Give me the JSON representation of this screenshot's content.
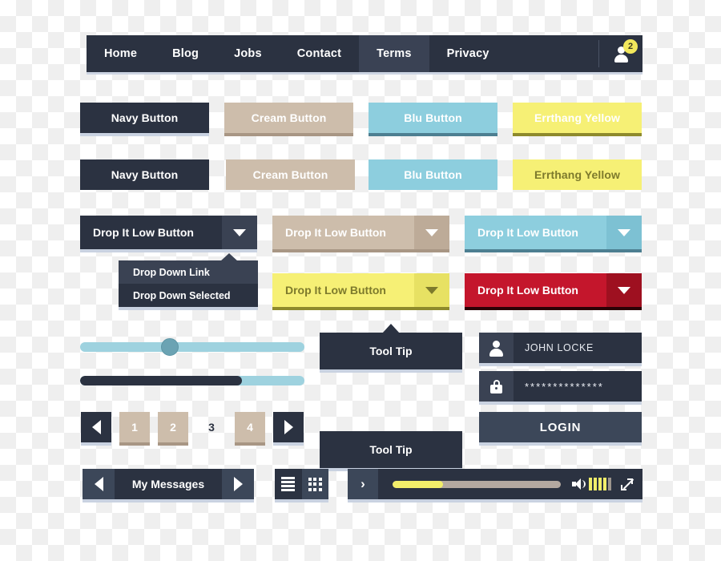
{
  "navbar": {
    "items": [
      {
        "label": "Home",
        "active": false
      },
      {
        "label": "Blog",
        "active": false
      },
      {
        "label": "Jobs",
        "active": false
      },
      {
        "label": "Contact",
        "active": false
      },
      {
        "label": "Terms",
        "active": true
      },
      {
        "label": "Privacy",
        "active": false
      }
    ],
    "user_icon": "user-icon",
    "badge_count": "2",
    "badge_color": "#f2e85c",
    "bg_color": "#2b3241",
    "active_bg_color": "#3a4254"
  },
  "buttons_row_raised": [
    {
      "label": "Navy Button",
      "style": "navy",
      "color": "#2b3241"
    },
    {
      "label": "Cream Button",
      "style": "cream",
      "color": "#cdbdab"
    },
    {
      "label": "Blu Button",
      "style": "blu",
      "color": "#8dcede"
    },
    {
      "label": "Errthang Yellow",
      "style": "yellow",
      "color": "#f6f075"
    }
  ],
  "buttons_row_flat": [
    {
      "label": "Navy Button",
      "style": "navy",
      "color": "#2b3241"
    },
    {
      "label": "Cream Button",
      "style": "cream",
      "color": "#cdbdab"
    },
    {
      "label": "Blu Button",
      "style": "blu",
      "color": "#8dcede"
    },
    {
      "label": "Errthang Yellow",
      "style": "yellow",
      "color": "#f6f075"
    }
  ],
  "dropdowns": [
    {
      "label": "Drop It Low Button",
      "style": "navy",
      "caret": "chevron-down-icon"
    },
    {
      "label": "Drop It Low Button",
      "style": "cream",
      "caret": "chevron-down-icon"
    },
    {
      "label": "Drop It Low Button",
      "style": "blu",
      "caret": "chevron-down-icon"
    },
    {
      "label": "Drop It Low Button",
      "style": "yellow",
      "caret": "chevron-down-icon"
    },
    {
      "label": "Drop It Low Button",
      "style": "red",
      "caret": "chevron-down-icon"
    }
  ],
  "dropdown_menu": {
    "items": [
      {
        "label": "Drop Down Link",
        "selected": false
      },
      {
        "label": "Drop Down Selected",
        "selected": true
      }
    ]
  },
  "slider": {
    "value_percent": 39,
    "track_color": "#9ed2df",
    "handle_color": "#6ba3b3"
  },
  "progress": {
    "value_percent": 72,
    "track_color": "#9ed2df",
    "fill_color": "#2b3241"
  },
  "tooltips": [
    {
      "label": "Tool Tip",
      "arrow": "top"
    },
    {
      "label": "Tool Tip",
      "arrow": "bottom"
    }
  ],
  "login": {
    "username_icon": "user-icon",
    "username_value": "JOHN LOCKE",
    "password_icon": "lock-icon",
    "password_value": "**************",
    "submit_label": "LOGIN"
  },
  "pagination": {
    "prev_icon": "triangle-left-icon",
    "next_icon": "triangle-right-icon",
    "pages": [
      {
        "label": "1",
        "active": false
      },
      {
        "label": "2",
        "active": false
      },
      {
        "label": "3",
        "active": true
      },
      {
        "label": "4",
        "active": false
      }
    ]
  },
  "messages": {
    "prev_icon": "triangle-left-icon",
    "title": "My Messages",
    "next_icon": "triangle-right-icon",
    "view_list_icon": "list-view-icon",
    "view_grid_icon": "grid-view-icon"
  },
  "player": {
    "play_icon": "play-chevron-icon",
    "play_glyph": "›",
    "progress_percent": 30,
    "progress_fill_color": "#f2ee6a",
    "progress_track_color": "#b3a8a0",
    "speaker_icon": "speaker-icon",
    "volume_level": 4,
    "volume_total": 5,
    "fullscreen_icon": "fullscreen-icon"
  }
}
